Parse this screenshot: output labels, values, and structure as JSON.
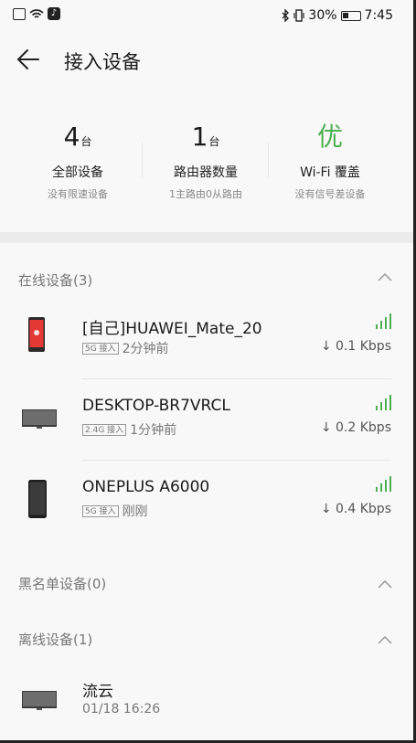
{
  "status_bar": {
    "battery_text": "30%",
    "time": "7:45"
  },
  "header": {
    "back_icon": "arrow-left-icon",
    "title": "接入设备"
  },
  "stats": [
    {
      "value": "4",
      "unit": "台",
      "label": "全部设备",
      "sub": "没有限速设备"
    },
    {
      "value": "1",
      "unit": "台",
      "label": "路由器数量",
      "sub": "1主路由0从路由"
    },
    {
      "value": "优",
      "unit": "",
      "label": "Wi-Fi 覆盖",
      "sub": "没有信号差设备",
      "color": "#4caf50"
    }
  ],
  "sections": {
    "online": {
      "title": "在线设备(3)",
      "devices": [
        {
          "name": "[自己]HUAWEI_Mate_20",
          "band": "5G 接入",
          "time": "2分钟前",
          "speed": "↓ 0.1 Kbps",
          "icon": "phone-red-icon"
        },
        {
          "name": "DESKTOP-BR7VRCL",
          "band": "2.4G 接入",
          "time": "1分钟前",
          "speed": "↓ 0.2 Kbps",
          "icon": "monitor-icon"
        },
        {
          "name": "ONEPLUS A6000",
          "band": "5G 接入",
          "time": "刚刚",
          "speed": "↓ 0.4 Kbps",
          "icon": "phone-black-icon"
        }
      ]
    },
    "blacklist": {
      "title": "黑名单设备(0)"
    },
    "offline": {
      "title": "离线设备(1)",
      "devices": [
        {
          "name": "流云",
          "time": "01/18 16:26",
          "icon": "monitor-icon"
        }
      ]
    }
  },
  "colors": {
    "signal_green": "#4caf50",
    "excellent_green": "#4caf50"
  }
}
